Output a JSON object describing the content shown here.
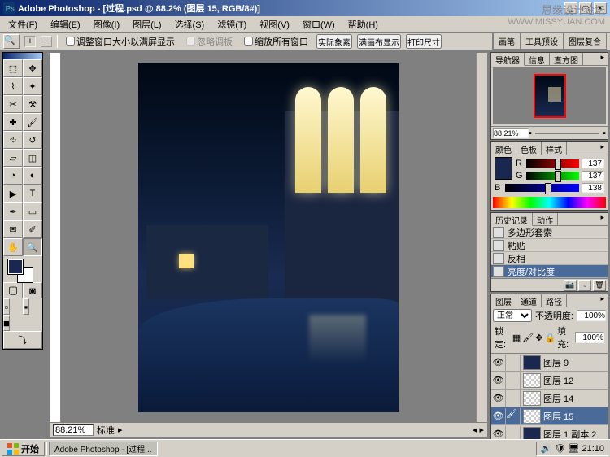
{
  "watermark": {
    "ch": "思缘设计论坛",
    "en": "WWW.MISSYUAN.COM"
  },
  "titlebar": {
    "title": "Adobe Photoshop - [过程.psd @ 88.2% (图层 15, RGB/8#)]"
  },
  "menu": {
    "file": "文件(F)",
    "edit": "编辑(E)",
    "image": "图像(I)",
    "layer": "图层(L)",
    "select": "选择(S)",
    "filter": "滤镜(T)",
    "view": "视图(V)",
    "window": "窗口(W)",
    "help": "帮助(H)"
  },
  "options": {
    "fit_screen": "调整窗口大小以满屏显示",
    "ignore_palettes": "忽略调板",
    "zoom_all": "缩放所有窗口",
    "actual_pixels": "实际象素",
    "fit_on_screen": "满画布显示",
    "print_size": "打印尺寸",
    "tab_brush": "画笔",
    "tab_tool_preset": "工具预设",
    "tab_layer_comp": "图层复合"
  },
  "navigator": {
    "tab_nav": "导航器",
    "tab_info": "信息",
    "tab_histogram": "直方图",
    "zoom": "88.21%"
  },
  "color": {
    "tab_color": "颜色",
    "tab_swatches": "色板",
    "tab_styles": "样式",
    "r_label": "R",
    "r_value": "137",
    "g_label": "G",
    "g_value": "137",
    "b_label": "B",
    "b_value": "138"
  },
  "history": {
    "tab_history": "历史记录",
    "tab_actions": "动作",
    "items": [
      {
        "label": "多边形套索"
      },
      {
        "label": "粘贴"
      },
      {
        "label": "反相"
      },
      {
        "label": "亮度/对比度"
      }
    ]
  },
  "layers": {
    "tab_layers": "图层",
    "tab_channels": "通道",
    "tab_paths": "路径",
    "blend_mode": "正常",
    "opacity_label": "不透明度:",
    "opacity_value": "100%",
    "lock_label": "锁定:",
    "fill_label": "填充:",
    "fill_value": "100%",
    "items": [
      {
        "name": "图层 9"
      },
      {
        "name": "图层 12"
      },
      {
        "name": "图层 14"
      },
      {
        "name": "图层 15"
      },
      {
        "name": "图层 1 副本 2"
      }
    ]
  },
  "status": {
    "zoom": "88.21%",
    "label": "标准"
  },
  "taskbar": {
    "start": "开始",
    "task1": "Adobe Photoshop - [过程...",
    "clock": "21:10"
  }
}
